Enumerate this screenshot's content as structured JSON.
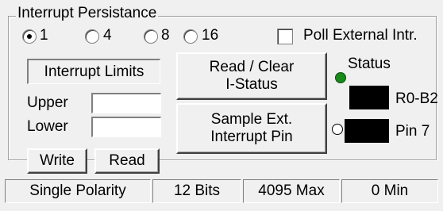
{
  "group": {
    "title": "Interrupt Persistance",
    "radios": [
      {
        "label": "1",
        "checked": true
      },
      {
        "label": "4",
        "checked": false
      },
      {
        "label": "8",
        "checked": false
      },
      {
        "label": "16",
        "checked": false
      }
    ],
    "poll_label": "Poll External Intr.",
    "poll_checked": false
  },
  "limits": {
    "title": "Interrupt Limits",
    "upper_label": "Upper",
    "lower_label": "Lower",
    "upper_value": "",
    "lower_value": "",
    "write_label": "Write",
    "read_label": "Read"
  },
  "buttons": {
    "read_clear_line1": "Read / Clear",
    "read_clear_line2": "I-Status",
    "sample_line1": "Sample  Ext.",
    "sample_line2": "Interrupt Pin"
  },
  "status": {
    "title": "Status",
    "r0b2_label": "R0-B2",
    "pin7_label": "Pin 7",
    "colors": {
      "led_on": "#1a8a1a",
      "indicator": "#000000"
    }
  },
  "statusbar": {
    "polarity": "Single Polarity",
    "bits": "12 Bits",
    "max": "4095 Max",
    "min": "0 Min"
  }
}
